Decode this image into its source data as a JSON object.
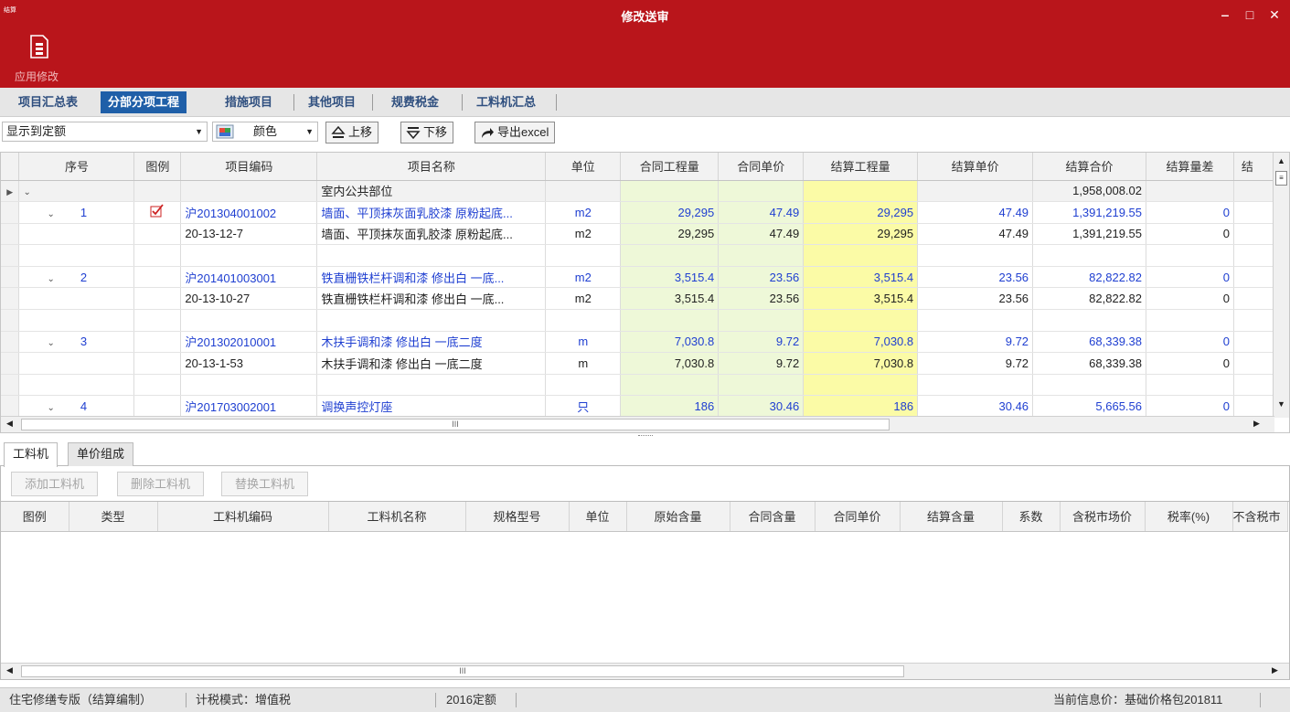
{
  "window": {
    "title": "修改送审",
    "logo_text": "结算",
    "minimize": "‒",
    "maximize": "□",
    "close": "✕"
  },
  "ribbon": {
    "apply_label": "应用修改"
  },
  "tabs": [
    {
      "label": "项目汇总表"
    },
    {
      "label": "分部分项工程"
    },
    {
      "label": "措施项目"
    },
    {
      "label": "其他项目"
    },
    {
      "label": "规费税金"
    },
    {
      "label": "工料机汇总"
    }
  ],
  "toolbar": {
    "display_select": "显示到定额",
    "color_label": "颜色",
    "move_up": "上移",
    "move_down": "下移",
    "export": "导出excel"
  },
  "grid": {
    "columns": [
      "序号",
      "图例",
      "项目编码",
      "项目名称",
      "单位",
      "合同工程量",
      "合同单价",
      "结算工程量",
      "结算单价",
      "结算合价",
      "结算量差",
      "结"
    ],
    "rows": [
      {
        "type": "group",
        "seq": "",
        "code": "",
        "name": "室内公共部位",
        "unit": "",
        "qty": "",
        "price": "",
        "sqty": "",
        "sprice": "",
        "stotal": "1,958,008.02",
        "diff": ""
      },
      {
        "type": "item",
        "seq": "1",
        "legend": true,
        "code": "沪201304001002",
        "name": "墙面、平顶抹灰面乳胶漆 原粉起底...",
        "unit": "m2",
        "qty": "29,295",
        "price": "47.49",
        "sqty": "29,295",
        "sprice": "47.49",
        "stotal": "1,391,219.55",
        "diff": "0"
      },
      {
        "type": "quota",
        "seq": "",
        "code": "20-13-12-7",
        "name": "墙面、平顶抹灰面乳胶漆 原粉起底...",
        "unit": "m2",
        "qty": "29,295",
        "price": "47.49",
        "sqty": "29,295",
        "sprice": "47.49",
        "stotal": "1,391,219.55",
        "diff": "0"
      },
      {
        "type": "empty"
      },
      {
        "type": "item",
        "seq": "2",
        "code": "沪201401003001",
        "name": "铁直栅铁栏杆调和漆 修出白 一底...",
        "unit": "m2",
        "qty": "3,515.4",
        "price": "23.56",
        "sqty": "3,515.4",
        "sprice": "23.56",
        "stotal": "82,822.82",
        "diff": "0"
      },
      {
        "type": "quota",
        "seq": "",
        "code": "20-13-10-27",
        "name": "铁直栅铁栏杆调和漆 修出白 一底...",
        "unit": "m2",
        "qty": "3,515.4",
        "price": "23.56",
        "sqty": "3,515.4",
        "sprice": "23.56",
        "stotal": "82,822.82",
        "diff": "0"
      },
      {
        "type": "empty"
      },
      {
        "type": "item",
        "seq": "3",
        "code": "沪201302010001",
        "name": "木扶手调和漆 修出白 一底二度",
        "unit": "m",
        "qty": "7,030.8",
        "price": "9.72",
        "sqty": "7,030.8",
        "sprice": "9.72",
        "stotal": "68,339.38",
        "diff": "0"
      },
      {
        "type": "quota",
        "seq": "",
        "code": "20-13-1-53",
        "name": "木扶手调和漆 修出白 一底二度",
        "unit": "m",
        "qty": "7,030.8",
        "price": "9.72",
        "sqty": "7,030.8",
        "sprice": "9.72",
        "stotal": "68,339.38",
        "diff": "0"
      },
      {
        "type": "empty"
      },
      {
        "type": "item",
        "seq": "4",
        "code": "沪201703002001",
        "name": "调换声控灯座",
        "unit": "只",
        "qty": "186",
        "price": "30.46",
        "sqty": "186",
        "sprice": "30.46",
        "stotal": "5,665.56",
        "diff": "0"
      }
    ],
    "scroll_grip": "III"
  },
  "lower": {
    "tabs": [
      "工料机",
      "单价组成"
    ],
    "buttons": [
      "添加工料机",
      "删除工料机",
      "替换工料机"
    ],
    "columns": [
      "图例",
      "类型",
      "工料机编码",
      "工料机名称",
      "规格型号",
      "单位",
      "原始含量",
      "合同含量",
      "合同单价",
      "结算含量",
      "系数",
      "含税市场价",
      "税率(%)",
      "不含税市"
    ]
  },
  "status": {
    "edition": "住宅修缮专版（结算编制）",
    "tax_mode": "计税模式：增值税",
    "quota": "2016定额",
    "price_info": "当前信息价：基础价格包201811"
  }
}
